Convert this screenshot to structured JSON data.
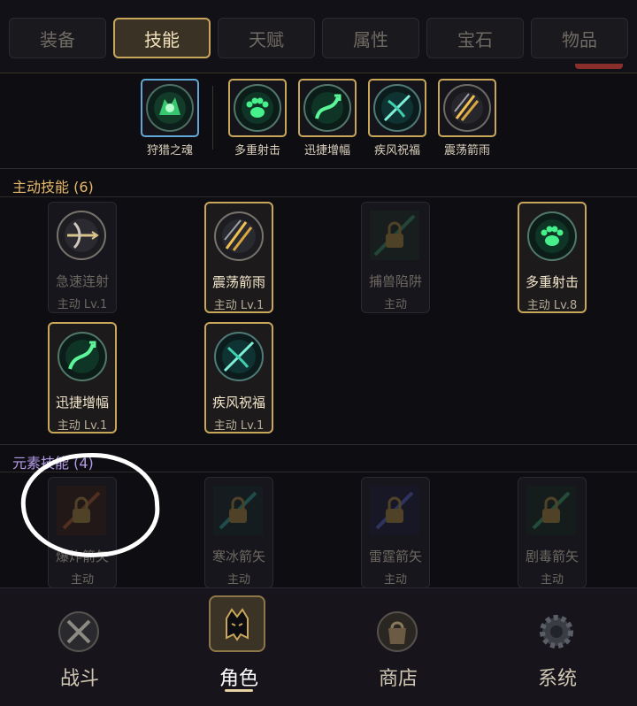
{
  "tabs": [
    {
      "label": "装备"
    },
    {
      "label": "技能"
    },
    {
      "label": "天赋"
    },
    {
      "label": "属性"
    },
    {
      "label": "宝石"
    },
    {
      "label": "物品"
    }
  ],
  "active_tab": "技能",
  "equipped": [
    {
      "name": "狩猎之魂",
      "icon": "wolf-spirit-icon",
      "frame": "blue"
    },
    {
      "name": "多重射击",
      "icon": "paw-icon",
      "frame": "gold"
    },
    {
      "name": "迅捷增幅",
      "icon": "swift-arrow-icon",
      "frame": "gold"
    },
    {
      "name": "疾风祝福",
      "icon": "bow-blessing-icon",
      "frame": "gold"
    },
    {
      "name": "震荡箭雨",
      "icon": "arrow-rain-icon",
      "frame": "gold"
    }
  ],
  "sections": {
    "active": {
      "title": "主动技能 (6)",
      "skills": [
        {
          "name": "急速连射",
          "level": "主动 Lv.1",
          "icon": "crossbow-icon",
          "equipped": false,
          "locked": false
        },
        {
          "name": "震荡箭雨",
          "level": "主动 Lv.1",
          "icon": "arrow-rain-icon",
          "equipped": true,
          "locked": false
        },
        {
          "name": "捕兽陷阱",
          "level": "主动",
          "icon": "lock-icon",
          "equipped": false,
          "locked": true
        },
        {
          "name": "多重射击",
          "level": "主动 Lv.8",
          "icon": "paw-icon",
          "equipped": true,
          "locked": false
        },
        {
          "name": "迅捷增幅",
          "level": "主动 Lv.1",
          "icon": "swift-arrow-icon",
          "equipped": true,
          "locked": false
        },
        {
          "name": "疾风祝福",
          "level": "主动 Lv.1",
          "icon": "bow-blessing-icon",
          "equipped": true,
          "locked": false
        }
      ]
    },
    "element": {
      "title": "元素技能 (4)",
      "skills": [
        {
          "name": "爆炸箭矢",
          "level": "主动",
          "icon": "lock-icon",
          "locked": true
        },
        {
          "name": "寒冰箭矢",
          "level": "主动",
          "icon": "lock-icon",
          "locked": true
        },
        {
          "name": "雷霆箭矢",
          "level": "主动",
          "icon": "lock-icon",
          "locked": true
        },
        {
          "name": "剧毒箭矢",
          "level": "主动",
          "icon": "lock-icon",
          "locked": true
        }
      ]
    }
  },
  "nav": [
    {
      "label": "战斗",
      "icon": "crossed-swords-icon"
    },
    {
      "label": "角色",
      "icon": "helmet-icon"
    },
    {
      "label": "商店",
      "icon": "bag-icon"
    },
    {
      "label": "系统",
      "icon": "gear-icon"
    }
  ],
  "colors": {
    "gold_frame": "#c8a65a",
    "soul_frame": "#62a8d6",
    "active_title": "#e6b96a",
    "element_title": "#b39ae6",
    "annotation": "#ffffff"
  }
}
